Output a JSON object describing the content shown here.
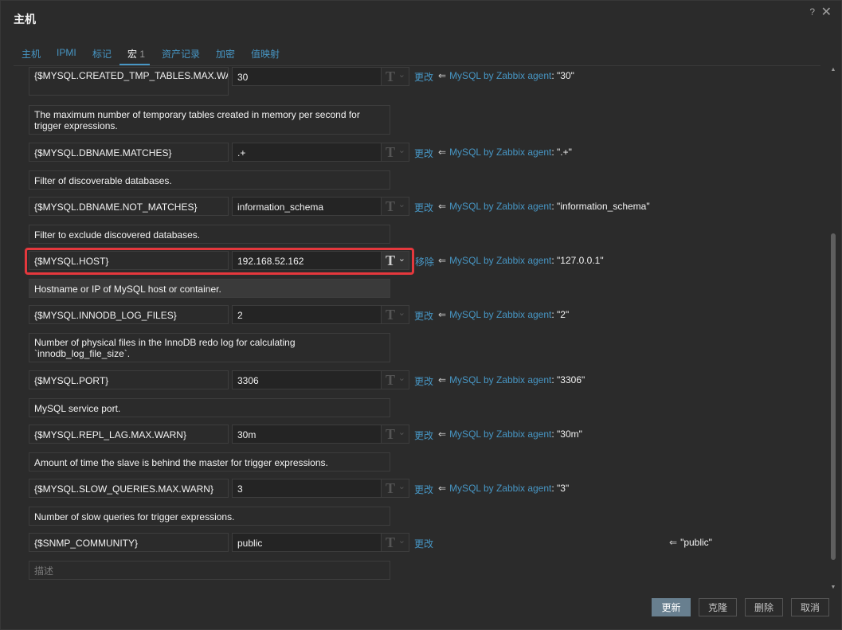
{
  "dialog": {
    "title": "主机",
    "help_icon": "?",
    "close_icon": "✕"
  },
  "tabs": [
    {
      "label": "主机"
    },
    {
      "label": "IPMI"
    },
    {
      "label": "标记"
    },
    {
      "label": "宏",
      "count": "1",
      "active": true
    },
    {
      "label": "资产记录"
    },
    {
      "label": "加密"
    },
    {
      "label": "值映射"
    }
  ],
  "macros": [
    {
      "macro": "{$MYSQL.CREATED_TMP_TABLES.MAX.WARN}",
      "value": "30",
      "action": "更改",
      "template": "MySQL by Zabbix agent",
      "inherited": "\"30\"",
      "description": "The maximum number of temporary tables created in memory per second for trigger expressions."
    },
    {
      "macro": "{$MYSQL.DBNAME.MATCHES}",
      "value": ".+",
      "action": "更改",
      "template": "MySQL by Zabbix agent",
      "inherited": "\".+\"",
      "description": "Filter of discoverable databases."
    },
    {
      "macro": "{$MYSQL.DBNAME.NOT_MATCHES}",
      "value": "information_schema",
      "action": "更改",
      "template": "MySQL by Zabbix agent",
      "inherited": "\"information_schema\"",
      "description": "Filter to exclude discovered databases."
    },
    {
      "macro": "{$MYSQL.HOST}",
      "value": "192.168.52.162",
      "action": "移除",
      "template": "MySQL by Zabbix agent",
      "inherited": "\"127.0.0.1\"",
      "description": "Hostname or IP of MySQL host or container."
    },
    {
      "macro": "{$MYSQL.INNODB_LOG_FILES}",
      "value": "2",
      "action": "更改",
      "template": "MySQL by Zabbix agent",
      "inherited": "\"2\"",
      "description": "Number of physical files in the InnoDB redo log for calculating `innodb_log_file_size`."
    },
    {
      "macro": "{$MYSQL.PORT}",
      "value": "3306",
      "action": "更改",
      "template": "MySQL by Zabbix agent",
      "inherited": "\"3306\"",
      "description": "MySQL service port."
    },
    {
      "macro": "{$MYSQL.REPL_LAG.MAX.WARN}",
      "value": "30m",
      "action": "更改",
      "template": "MySQL by Zabbix agent",
      "inherited": "\"30m\"",
      "description": "Amount of time the slave is behind the master for trigger expressions."
    },
    {
      "macro": "{$MYSQL.SLOW_QUERIES.MAX.WARN}",
      "value": "3",
      "action": "更改",
      "template": "MySQL by Zabbix agent",
      "inherited": "\"3\"",
      "description": "Number of slow queries for trigger expressions."
    },
    {
      "macro": "{$SNMP_COMMUNITY}",
      "value": "public",
      "action": "更改",
      "template": "",
      "inherited": "\"public\"",
      "description": ""
    }
  ],
  "description_placeholder": "描述",
  "type_icon": "T",
  "type_chevron": "⌄",
  "inherit_arrow": "⇐",
  "footer": {
    "update": "更新",
    "clone": "克隆",
    "delete": "删除",
    "cancel": "取消"
  }
}
